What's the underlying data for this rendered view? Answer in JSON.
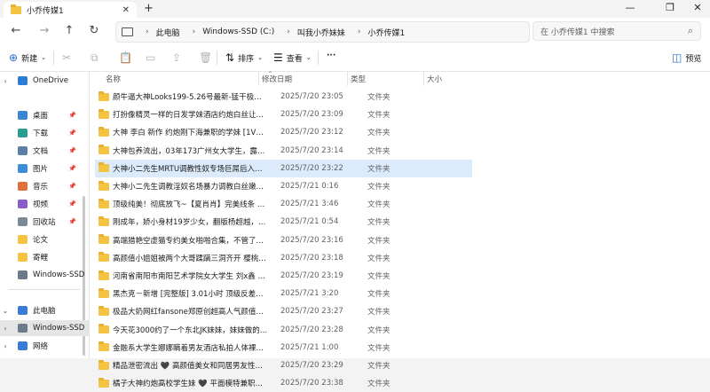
{
  "window": {
    "tab_title": "小乔传媒1",
    "tab_close": "✕",
    "new_tab": "+",
    "minimize": "—",
    "maximize": "❐",
    "close": "✕"
  },
  "nav": {
    "back": "←",
    "forward": "→",
    "up": "↑",
    "refresh": "↻",
    "breadcrumbs": [
      "此电脑",
      "Windows-SSD (C:)",
      "叫我小乔妹妹",
      "小乔传媒1"
    ],
    "search_placeholder": "在 小乔传媒1 中搜索"
  },
  "toolbar": {
    "new_label": "新建",
    "sort_label": "排序",
    "view_label": "查看",
    "more_label": "···",
    "preview_label": "预览"
  },
  "sidebar": {
    "items": [
      {
        "label": "OneDrive",
        "pinned": false,
        "color": "#2b7cd3",
        "chev": "›"
      },
      {
        "label": "桌面",
        "pinned": true,
        "color": "#3a86d4",
        "chev": ""
      },
      {
        "label": "下载",
        "pinned": true,
        "color": "#2a9d8f",
        "chev": ""
      },
      {
        "label": "文档",
        "pinned": true,
        "color": "#5b7fa6",
        "chev": ""
      },
      {
        "label": "图片",
        "pinned": true,
        "color": "#3b8fd8",
        "chev": ""
      },
      {
        "label": "音乐",
        "pinned": true,
        "color": "#e0703a",
        "chev": ""
      },
      {
        "label": "视频",
        "pinned": true,
        "color": "#8a5cc9",
        "chev": ""
      },
      {
        "label": "回收站",
        "pinned": true,
        "color": "#7a8a99",
        "chev": ""
      },
      {
        "label": "论文",
        "pinned": false,
        "color": "#f5c342",
        "chev": ""
      },
      {
        "label": "寄鲤",
        "pinned": false,
        "color": "#f5c342",
        "chev": ""
      },
      {
        "label": "Windows-SSD",
        "pinned": false,
        "color": "#6b7b8c",
        "chev": ""
      },
      {
        "label": "此电脑",
        "pinned": false,
        "color": "#3a7bd5",
        "chev": "⌄"
      },
      {
        "label": "Windows-SSD",
        "pinned": false,
        "color": "#6b7b8c",
        "chev": "›"
      },
      {
        "label": "网络",
        "pinned": false,
        "color": "#3a7bd5",
        "chev": "›"
      }
    ],
    "pin_glyph": "📌"
  },
  "columns": {
    "name": "名称",
    "date": "修改日期",
    "type": "类型",
    "size": "大小"
  },
  "files": [
    {
      "name": "颜牛逼大神Looks199-5.26号最新-猛干极度反…",
      "date": "2025/7/20 23:05",
      "type": "文件夹"
    },
    {
      "name": "打扮像精灵一样的日发学妹酒店约炮白丝让金主…",
      "date": "2025/7/20 23:09",
      "type": "文件夹"
    },
    {
      "name": "大神 李白 新作 约炮刚下海兼职的学妹 [1V+72…",
      "date": "2025/7/20 23:12",
      "type": "文件夹"
    },
    {
      "name": "大神包养流出，03年173广州女大学生，露脸…",
      "date": "2025/7/20 23:14",
      "type": "文件夹"
    },
    {
      "name": "大神小二先生MRTU调教性奴专场巨屌后入手淫…",
      "date": "2025/7/20 23:22",
      "type": "文件夹"
    },
    {
      "name": "大神小二先生调教淫奴名场暴力调教白丝嫩萝莉",
      "date": "2025/7/21 0:16",
      "type": "文件夹"
    },
    {
      "name": "顶级纯美！彻底放飞~【夏肖肖】完美线条 鸡巴…",
      "date": "2025/7/21 3:46",
      "type": "文件夹"
    },
    {
      "name": "刚成年，娇小身材19岁少女，翻版杨超越，【…",
      "date": "2025/7/21 0:54",
      "type": "文件夹"
    },
    {
      "name": "高端猎艳空虚猫专约美女啪啪合集，不管了，直…",
      "date": "2025/7/20 23:16",
      "type": "文件夹"
    },
    {
      "name": "高颜值小姐姐被两个大哥蹂躏三洞齐开 樱桃小…",
      "date": "2025/7/20 23:18",
      "type": "文件夹"
    },
    {
      "name": "河南省南阳市南阳艺术学院女大学生 刘x鑫 性…",
      "date": "2025/7/20 23:19",
      "type": "文件夹"
    },
    {
      "name": "黑杰克－新增 [完整版] 3.01小时 顶级反差母狗…",
      "date": "2025/7/21 3:20",
      "type": "文件夹"
    },
    {
      "name": "极品大奶网红fansone郑原创超高人气颜值网红…",
      "date": "2025/7/20 23:27",
      "type": "文件夹"
    },
    {
      "name": "今天花3000约了一个东北JK妹妹，妹妹做的时…",
      "date": "2025/7/20 23:28",
      "type": "文件夹"
    },
    {
      "name": "金融系大学生娜娜瞒着男友酒店私拍人体裸照、…",
      "date": "2025/7/21 1:00",
      "type": "文件夹"
    },
    {
      "name": "精品泄密流出 🖤 高颜值美女和同居男友性爱自…",
      "date": "2025/7/20 23:29",
      "type": "文件夹"
    },
    {
      "name": "橘子大神约炮高校学生妹 🖤 平面模特兼职少女…",
      "date": "2025/7/20 23:38",
      "type": "文件夹"
    }
  ],
  "selected_index": 4
}
